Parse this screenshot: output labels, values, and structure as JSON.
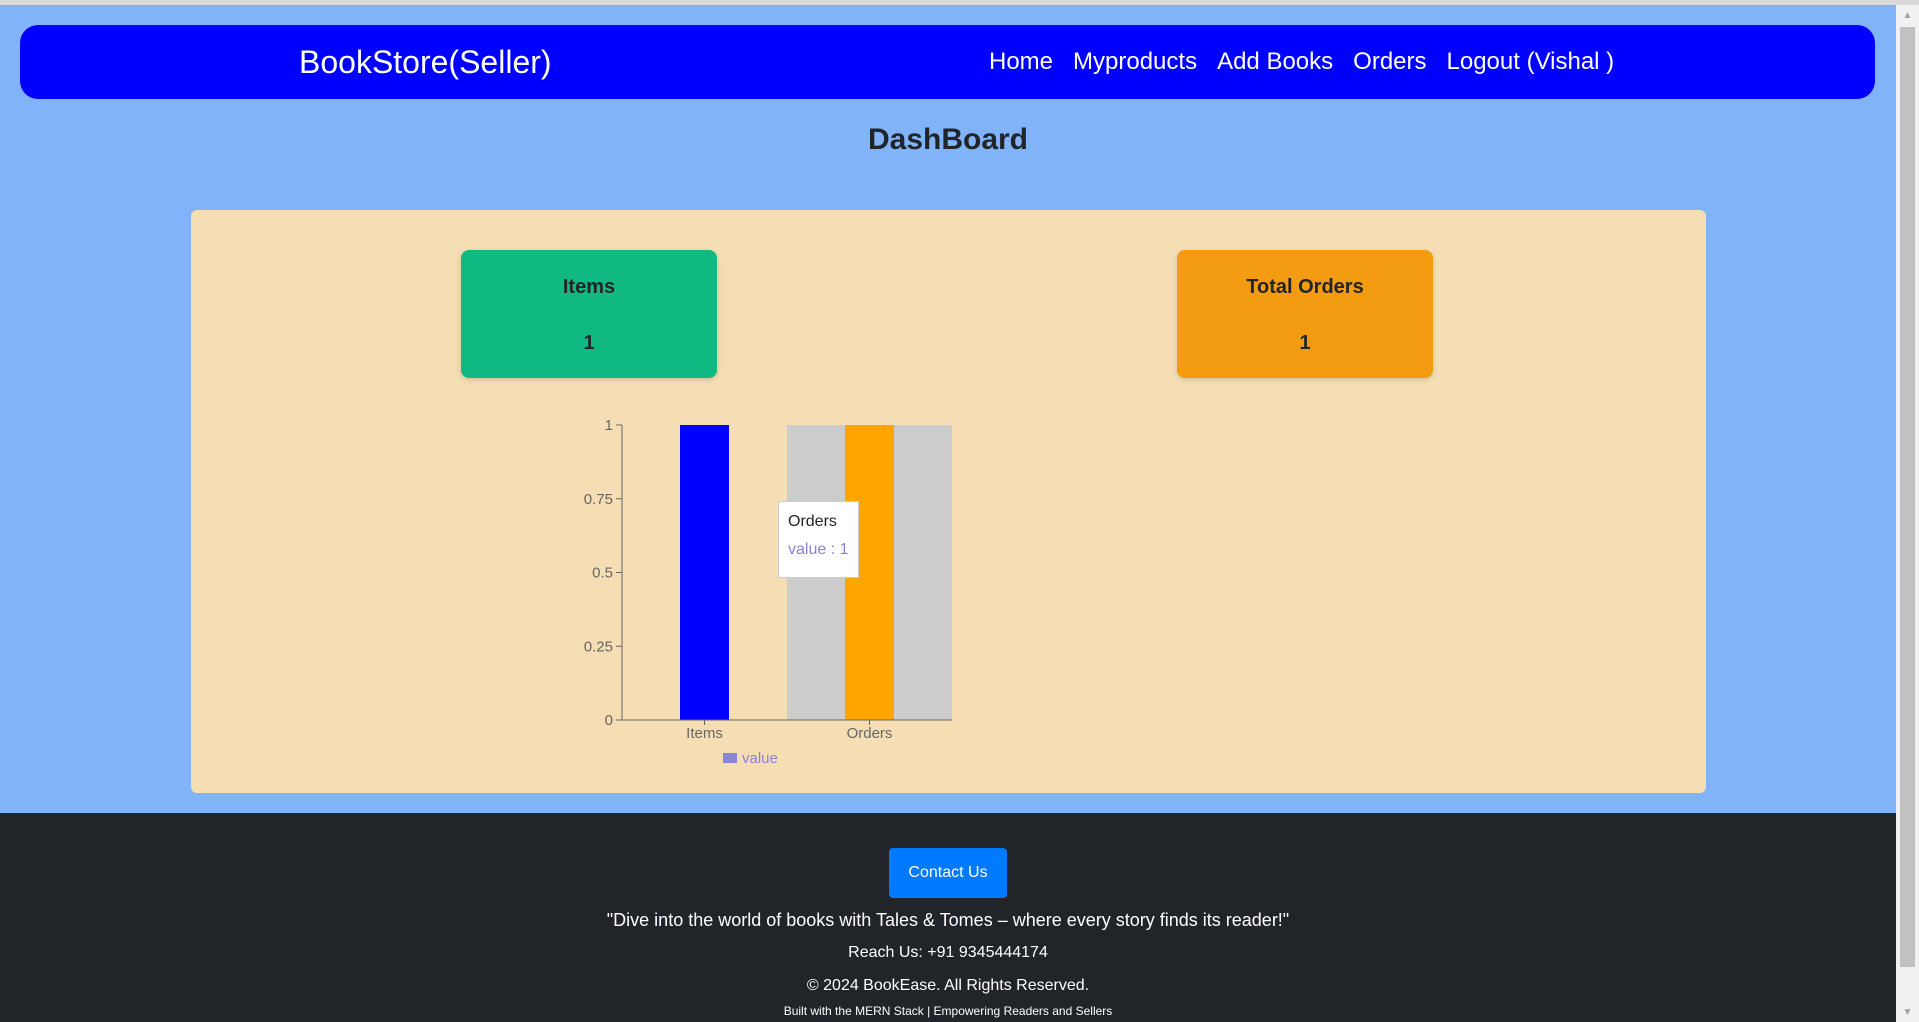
{
  "navbar": {
    "brand": "BookStore(Seller)",
    "links": [
      "Home",
      "Myproducts",
      "Add Books",
      "Orders",
      "Logout (Vishal )"
    ]
  },
  "page": {
    "title": "DashBoard"
  },
  "cards": {
    "items": {
      "title": "Items",
      "value": "1",
      "color": "#10b981"
    },
    "orders": {
      "title": "Total Orders",
      "value": "1",
      "color": "#f39c12"
    }
  },
  "chart_data": {
    "type": "bar",
    "categories": [
      "Items",
      "Orders"
    ],
    "values": [
      1,
      1
    ],
    "bar_colors": [
      "#0000ff",
      "#ffa500"
    ],
    "ylim": [
      0,
      1
    ],
    "yticks": [
      "0",
      "0.25",
      "0.5",
      "0.75",
      "1"
    ],
    "legend": "value",
    "legend_color": "#8884d8",
    "grid": false,
    "hover_category": "Orders"
  },
  "tooltip": {
    "title": "Orders",
    "value": "value : 1"
  },
  "footer": {
    "contact_label": "Contact Us",
    "tagline": "\"Dive into the world of books with Tales & Tomes – where every story finds its reader!\"",
    "reach": "Reach Us: +91 9345444174",
    "copyright": "© 2024 BookEase. All Rights Reserved.",
    "built": "Built with the MERN Stack | Empowering Readers and Sellers"
  }
}
